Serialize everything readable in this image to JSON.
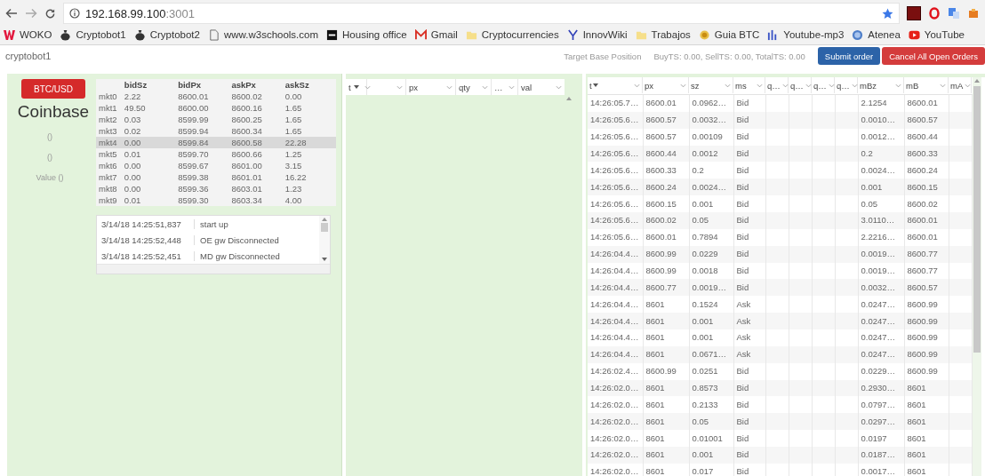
{
  "browser": {
    "url_host": "192.168.99.100",
    "url_port": ":3001",
    "bookmarks": [
      {
        "label": "WOKO",
        "kind": "w-logo"
      },
      {
        "label": "Cryptobot1",
        "kind": "bag"
      },
      {
        "label": "Cryptobot2",
        "kind": "bag"
      },
      {
        "label": "www.w3schools.com",
        "kind": "page"
      },
      {
        "label": "Housing office",
        "kind": "dark"
      },
      {
        "label": "Gmail",
        "kind": "mail"
      },
      {
        "label": "Cryptocurrencies",
        "kind": "folder"
      },
      {
        "label": "InnovWiki",
        "kind": "wiki"
      },
      {
        "label": "Trabajos",
        "kind": "folder"
      },
      {
        "label": "Guia BTC",
        "kind": "coin"
      },
      {
        "label": "Youtube-mp3",
        "kind": "mp3"
      },
      {
        "label": "Atenea",
        "kind": "globe"
      },
      {
        "label": "YouTube",
        "kind": "video"
      }
    ]
  },
  "header": {
    "title": "cryptobot1",
    "target_label": "Target Base Position",
    "totals": "BuyTS: 0.00, SellTS: 0.00, TotalTS: 0.00",
    "buttons": [
      {
        "label": "Submit order",
        "kind": "primary"
      },
      {
        "label": "Cancel All Open Orders",
        "kind": "danger"
      }
    ]
  },
  "left": {
    "pair_button": "BTC/USD",
    "exchange": "Coinbase",
    "fields": [
      "()",
      "()",
      "Value ()"
    ],
    "market_table": {
      "columns": [
        "bidSz",
        "bidPx",
        "askPx",
        "askSz"
      ],
      "rows": [
        {
          "name": "mkt0",
          "cells": [
            "2.22",
            "8600.01",
            "8600.02",
            "0.00"
          ],
          "selected": false
        },
        {
          "name": "mkt1",
          "cells": [
            "49.50",
            "8600.00",
            "8600.16",
            "1.65"
          ],
          "selected": false
        },
        {
          "name": "mkt2",
          "cells": [
            "0.03",
            "8599.99",
            "8600.25",
            "1.65"
          ],
          "selected": false
        },
        {
          "name": "mkt3",
          "cells": [
            "0.02",
            "8599.94",
            "8600.34",
            "1.65"
          ],
          "selected": false
        },
        {
          "name": "mkt4",
          "cells": [
            "0.00",
            "8599.84",
            "8600.58",
            "22.28"
          ],
          "selected": true
        },
        {
          "name": "mkt5",
          "cells": [
            "0.01",
            "8599.70",
            "8600.66",
            "1.25"
          ],
          "selected": false
        },
        {
          "name": "mkt6",
          "cells": [
            "0.00",
            "8599.67",
            "8601.00",
            "3.15"
          ],
          "selected": false
        },
        {
          "name": "mkt7",
          "cells": [
            "0.00",
            "8599.38",
            "8601.01",
            "16.22"
          ],
          "selected": false
        },
        {
          "name": "mkt8",
          "cells": [
            "0.00",
            "8599.36",
            "8603.01",
            "1.23"
          ],
          "selected": false
        },
        {
          "name": "mkt9",
          "cells": [
            "0.01",
            "8599.30",
            "8603.34",
            "4.00"
          ],
          "selected": false
        }
      ]
    },
    "log": [
      {
        "time": "3/14/18 14:25:51,837",
        "message": "start up"
      },
      {
        "time": "3/14/18 14:25:52,448",
        "message": "OE gw Disconnected"
      },
      {
        "time": "3/14/18 14:25:52,451",
        "message": "MD gw Disconnected"
      }
    ]
  },
  "orders_table": {
    "columns": [
      {
        "label": "t",
        "sorted": true
      },
      {
        "sorted": false
      },
      {
        "label": "px",
        "sorted": false
      },
      {
        "label": "qty",
        "sorted": false
      },
      {
        "label": "…",
        "sorted": false
      },
      {
        "label": "val",
        "sorted": false
      }
    ]
  },
  "trades_table": {
    "columns": [
      {
        "label": "t",
        "sorted": true
      },
      {
        "label": "px",
        "sorted": false
      },
      {
        "label": "sz",
        "sorted": false
      },
      {
        "label": "ms",
        "sorted": false
      },
      {
        "label": "q…",
        "sorted": false
      },
      {
        "label": "q…",
        "sorted": false
      },
      {
        "label": "q…",
        "sorted": false
      },
      {
        "label": "q…",
        "sorted": false
      },
      {
        "label": "mBz",
        "sorted": false
      },
      {
        "label": "mB",
        "sorted": false
      },
      {
        "label": "mA",
        "sorted": false
      }
    ],
    "rows": [
      [
        "14:26:05.7…",
        "8600.01",
        "0.0962…",
        "Bid",
        "2.1254",
        "8600.01"
      ],
      [
        "14:26:05.6…",
        "8600.57",
        "0.0032…",
        "Bid",
        "0.0010…",
        "8600.57"
      ],
      [
        "14:26:05.6…",
        "8600.57",
        "0.00109",
        "Bid",
        "0.0012…",
        "8600.44"
      ],
      [
        "14:26:05.6…",
        "8600.44",
        "0.0012",
        "Bid",
        "0.2",
        "8600.33"
      ],
      [
        "14:26:05.6…",
        "8600.33",
        "0.2",
        "Bid",
        "0.0024…",
        "8600.24"
      ],
      [
        "14:26:05.6…",
        "8600.24",
        "0.0024…",
        "Bid",
        "0.001",
        "8600.15"
      ],
      [
        "14:26:05.6…",
        "8600.15",
        "0.001",
        "Bid",
        "0.05",
        "8600.02"
      ],
      [
        "14:26:05.6…",
        "8600.02",
        "0.05",
        "Bid",
        "3.0110…",
        "8600.01"
      ],
      [
        "14:26:05.6…",
        "8600.01",
        "0.7894",
        "Bid",
        "2.2216…",
        "8600.01"
      ],
      [
        "14:26:04.4…",
        "8600.99",
        "0.0229",
        "Bid",
        "0.0019…",
        "8600.77"
      ],
      [
        "14:26:04.4…",
        "8600.99",
        "0.0018",
        "Bid",
        "0.0019…",
        "8600.77"
      ],
      [
        "14:26:04.4…",
        "8600.77",
        "0.0019…",
        "Bid",
        "0.0032…",
        "8600.57"
      ],
      [
        "14:26:04.4…",
        "8601",
        "0.1524",
        "Ask",
        "0.0247…",
        "8600.99"
      ],
      [
        "14:26:04.4…",
        "8601",
        "0.001",
        "Ask",
        "0.0247…",
        "8600.99"
      ],
      [
        "14:26:04.4…",
        "8601",
        "0.001",
        "Ask",
        "0.0247…",
        "8600.99"
      ],
      [
        "14:26:04.4…",
        "8601",
        "0.0671…",
        "Ask",
        "0.0247…",
        "8600.99"
      ],
      [
        "14:26:02.4…",
        "8600.99",
        "0.0251",
        "Bid",
        "0.0229…",
        "8600.99"
      ],
      [
        "14:26:02.0…",
        "8601",
        "0.8573",
        "Bid",
        "0.2930…",
        "8601"
      ],
      [
        "14:26:02.0…",
        "8601",
        "0.2133",
        "Bid",
        "0.0797…",
        "8601"
      ],
      [
        "14:26:02.0…",
        "8601",
        "0.05",
        "Bid",
        "0.0297…",
        "8601"
      ],
      [
        "14:26:02.0…",
        "8601",
        "0.01001",
        "Bid",
        "0.0197",
        "8601"
      ],
      [
        "14:26:02.0…",
        "8601",
        "0.001",
        "Bid",
        "0.0187…",
        "8601"
      ],
      [
        "14:26:02.0…",
        "8601",
        "0.017",
        "Bid",
        "0.0017…",
        "8601"
      ]
    ]
  }
}
